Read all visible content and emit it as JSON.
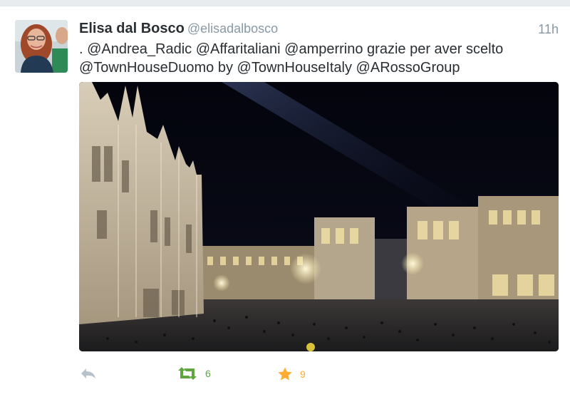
{
  "tweet": {
    "author_name": "Elisa dal Bosco",
    "handle": "@elisadalbosco",
    "time": "11h",
    "text": ". @Andrea_Radic @Affaritaliani @amperrino grazie per aver scelto @TownHouseDuomo by @TownHouseItaly @ARossoGroup",
    "retweet_count": "6",
    "favorite_count": "9"
  },
  "icons": {
    "reply": "reply-icon",
    "retweet": "retweet-icon",
    "favorite": "star-icon"
  },
  "colors": {
    "retweet_active": "#5fa641",
    "favorite_active": "#ffac33",
    "muted": "#8899a6"
  }
}
